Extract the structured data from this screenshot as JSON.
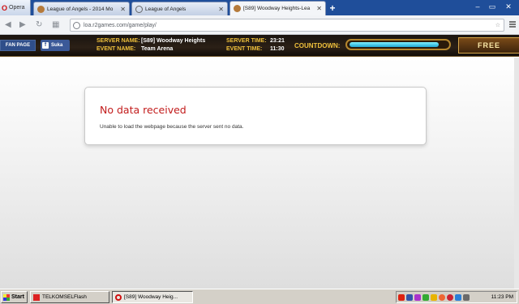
{
  "browser": {
    "menu_label": "Opera",
    "tabs": [
      {
        "title": "League of Angels - 2014 Mo"
      },
      {
        "title": "League of Angels"
      },
      {
        "title": "[S89] Woodway Heights-Lea"
      }
    ],
    "new_tab_label": "+",
    "url": "loa.r2games.com/game/play/"
  },
  "banner": {
    "fan_page_label": "FAN PAGE",
    "like_label": "Suka",
    "server_name_key": "SERVER NAME:",
    "server_name_value": "[S89] Woodway Heights",
    "event_name_key": "EVENT NAME:",
    "event_name_value": "Team Arena",
    "server_time_key": "SERVER TIME:",
    "server_time_value": "23:21",
    "event_time_key": "EVENT TIME:",
    "event_time_value": "11:30",
    "countdown_label": "COUNTDOWN:",
    "countdown_progress": 0.92,
    "free_label": "FREE"
  },
  "error": {
    "title": "No data received",
    "message": "Unable to load the webpage because the server sent no data."
  },
  "taskbar": {
    "start_label": "Start",
    "buttons": [
      {
        "label": "TELKOMSELFlash"
      },
      {
        "label": "[S89] Woodway Heig..."
      }
    ],
    "clock": "11:23 PM"
  },
  "colors": {
    "tabstrip": "#1f4e9a",
    "error_title": "#c21b1b",
    "banner_gold": "#f0c13c",
    "taskbar": "#d4d0c8"
  }
}
